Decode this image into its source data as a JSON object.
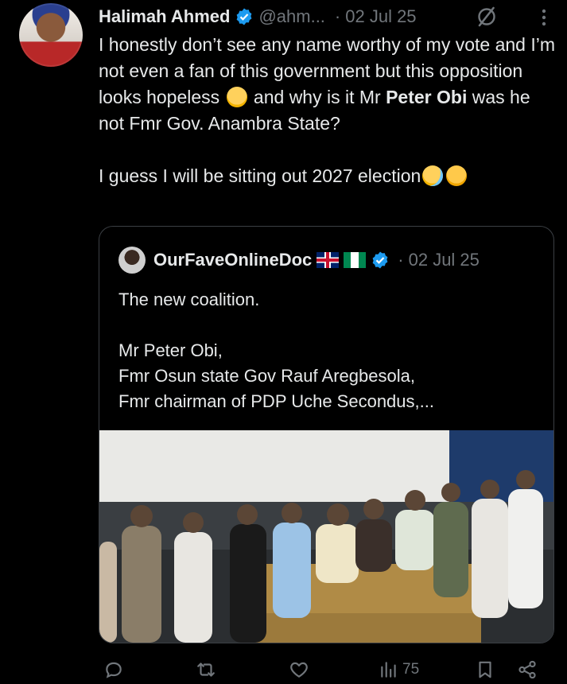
{
  "tweet": {
    "author_name": "Halimah Ahmed",
    "handle": "@ahm...",
    "separator": "·",
    "date": "02 Jul 25",
    "text_segments": {
      "p1_a": "I honestly don’t see any name worthy of my vote and I’m not even a fan of this government but this opposition looks hopeless ",
      "p1_b": " and why is it Mr ",
      "p1_bold": "Peter Obi",
      "p1_c": " was he not Fmr Gov. Anambra State?",
      "p2": "I guess I will be sitting out 2027 election"
    }
  },
  "quote": {
    "author_name": "OurFaveOnlineDoc",
    "separator": "·",
    "date": "02 Jul 25",
    "text": "The new coalition.\n\nMr Peter Obi,\nFmr Osun state Gov Rauf Aregbesola,\nFmr chairman of PDP Uche Secondus,..."
  },
  "actions": {
    "views_count": "75"
  },
  "colors": {
    "background": "#000000",
    "text": "#e7e9ea",
    "muted": "#71767b",
    "verified": "#1d9bf0",
    "border": "#3b3f44"
  },
  "icons": [
    "verified-badge-icon",
    "grok-icon",
    "more-icon",
    "reply-icon",
    "retweet-icon",
    "like-icon",
    "views-icon",
    "bookmark-icon",
    "share-icon",
    "uk-flag-icon",
    "nigeria-flag-icon"
  ]
}
